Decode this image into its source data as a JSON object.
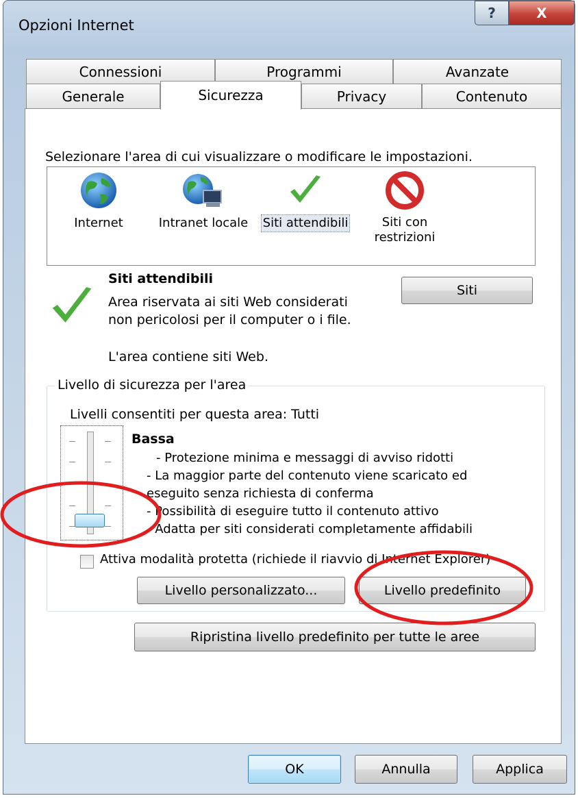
{
  "window": {
    "title": "Opzioni Internet",
    "help_label": "?",
    "close_label": "X"
  },
  "tabs": {
    "row1": [
      "Connessioni",
      "Programmi",
      "Avanzate"
    ],
    "row2": [
      "Generale",
      "Sicurezza",
      "Privacy",
      "Contenuto"
    ],
    "active": "Sicurezza"
  },
  "security": {
    "instruction": "Selezionare l'area di cui visualizzare o modificare le impostazioni.",
    "zones": [
      {
        "label": "Internet",
        "icon": "globe-icon"
      },
      {
        "label": "Intranet locale",
        "icon": "globe-network-icon"
      },
      {
        "label": "Siti attendibili",
        "icon": "green-checkmark-icon",
        "selected": true
      },
      {
        "label_line1": "Siti con",
        "label_line2": "restrizioni",
        "icon": "red-prohibited-icon"
      }
    ],
    "selected_zone": {
      "title": "Siti attendibili",
      "desc_line1": "Area riservata ai siti Web considerati",
      "desc_line2": "non pericolosi per il computer o i file.",
      "contains": "L'area contiene siti Web."
    },
    "sites_button": "Siti",
    "level_group": {
      "legend": "Livello di sicurezza per l'area",
      "allowed": "Livelli consentiti per questa area: Tutti",
      "level_name": "Bassa",
      "bullets": [
        "- Protezione minima e messaggi di avviso ridotti",
        "- La maggior parte del contenuto viene scaricato ed",
        "eseguito senza richiesta di conferma",
        "- Possibilità di eseguire tutto il contenuto attivo",
        "- Adatta per siti considerati completamente affidabili"
      ],
      "slider_level": 0,
      "protected_mode": "Attiva modalità protetta (richiede il riavvio di Internet Explorer)",
      "protected_mode_checked": false,
      "custom_level_button": "Livello personalizzato...",
      "default_level_button": "Livello predefinito"
    },
    "reset_all_button": "Ripristina livello predefinito per tutte le aree"
  },
  "footer": {
    "ok": "OK",
    "cancel": "Annulla",
    "apply": "Applica"
  },
  "annotation_color": "#e11d1d"
}
